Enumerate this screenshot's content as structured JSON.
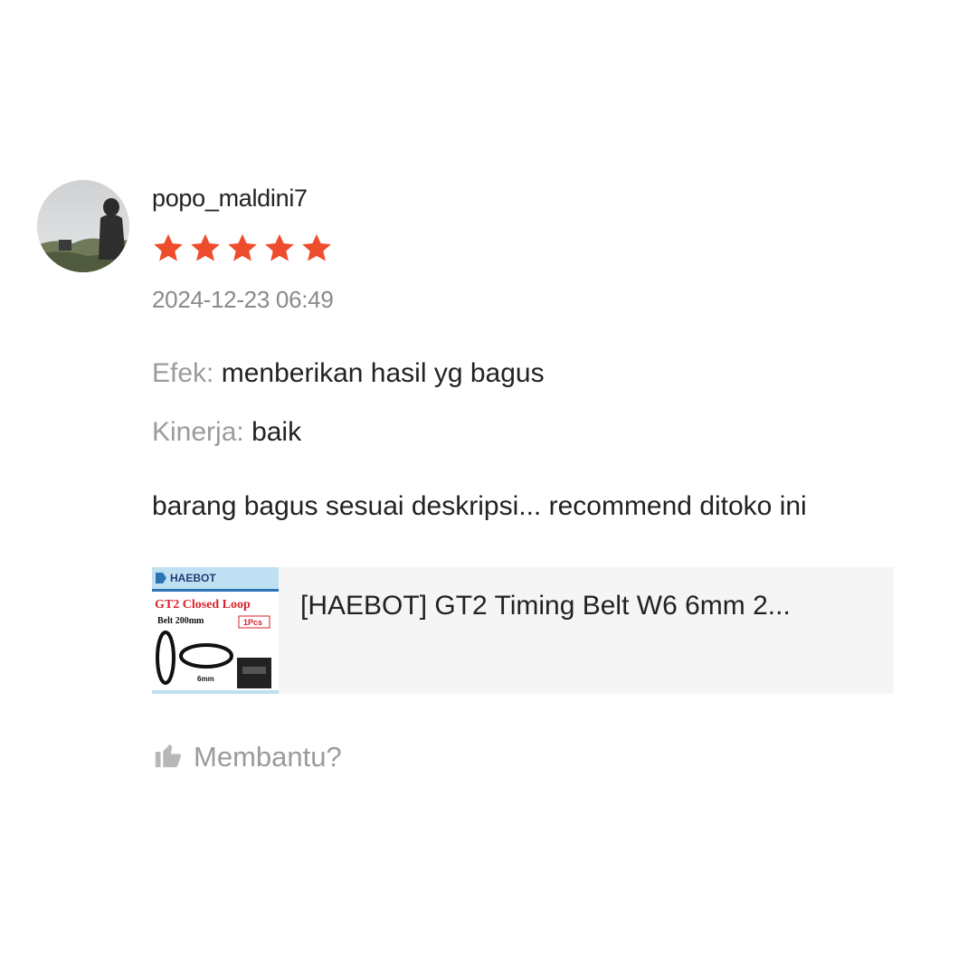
{
  "review": {
    "username": "popo_maldini7",
    "rating": 5,
    "rating_max": 5,
    "timestamp": "2024-12-23 06:49",
    "attributes": [
      {
        "key": "Efek:",
        "value": "menberikan hasil yg bagus"
      },
      {
        "key": "Kinerja:",
        "value": "baik"
      }
    ],
    "comment": "barang bagus sesuai deskripsi... recommend ditoko ini",
    "product": {
      "title": "[HAEBOT] GT2 Timing Belt W6 6mm 2...",
      "thumbnail": {
        "brand": "HAEBOT",
        "line1": "GT2 Closed Loop",
        "line2": "Belt 200mm",
        "badge": "1Pcs",
        "width_label": "6mm"
      }
    },
    "helpful": {
      "label": "Membantu?",
      "icon": "thumbs-up-icon"
    }
  },
  "colors": {
    "star": "#ee4d2d",
    "muted_text": "#9b9b9b",
    "body_text": "#222222",
    "card_bg": "#f5f5f5"
  }
}
